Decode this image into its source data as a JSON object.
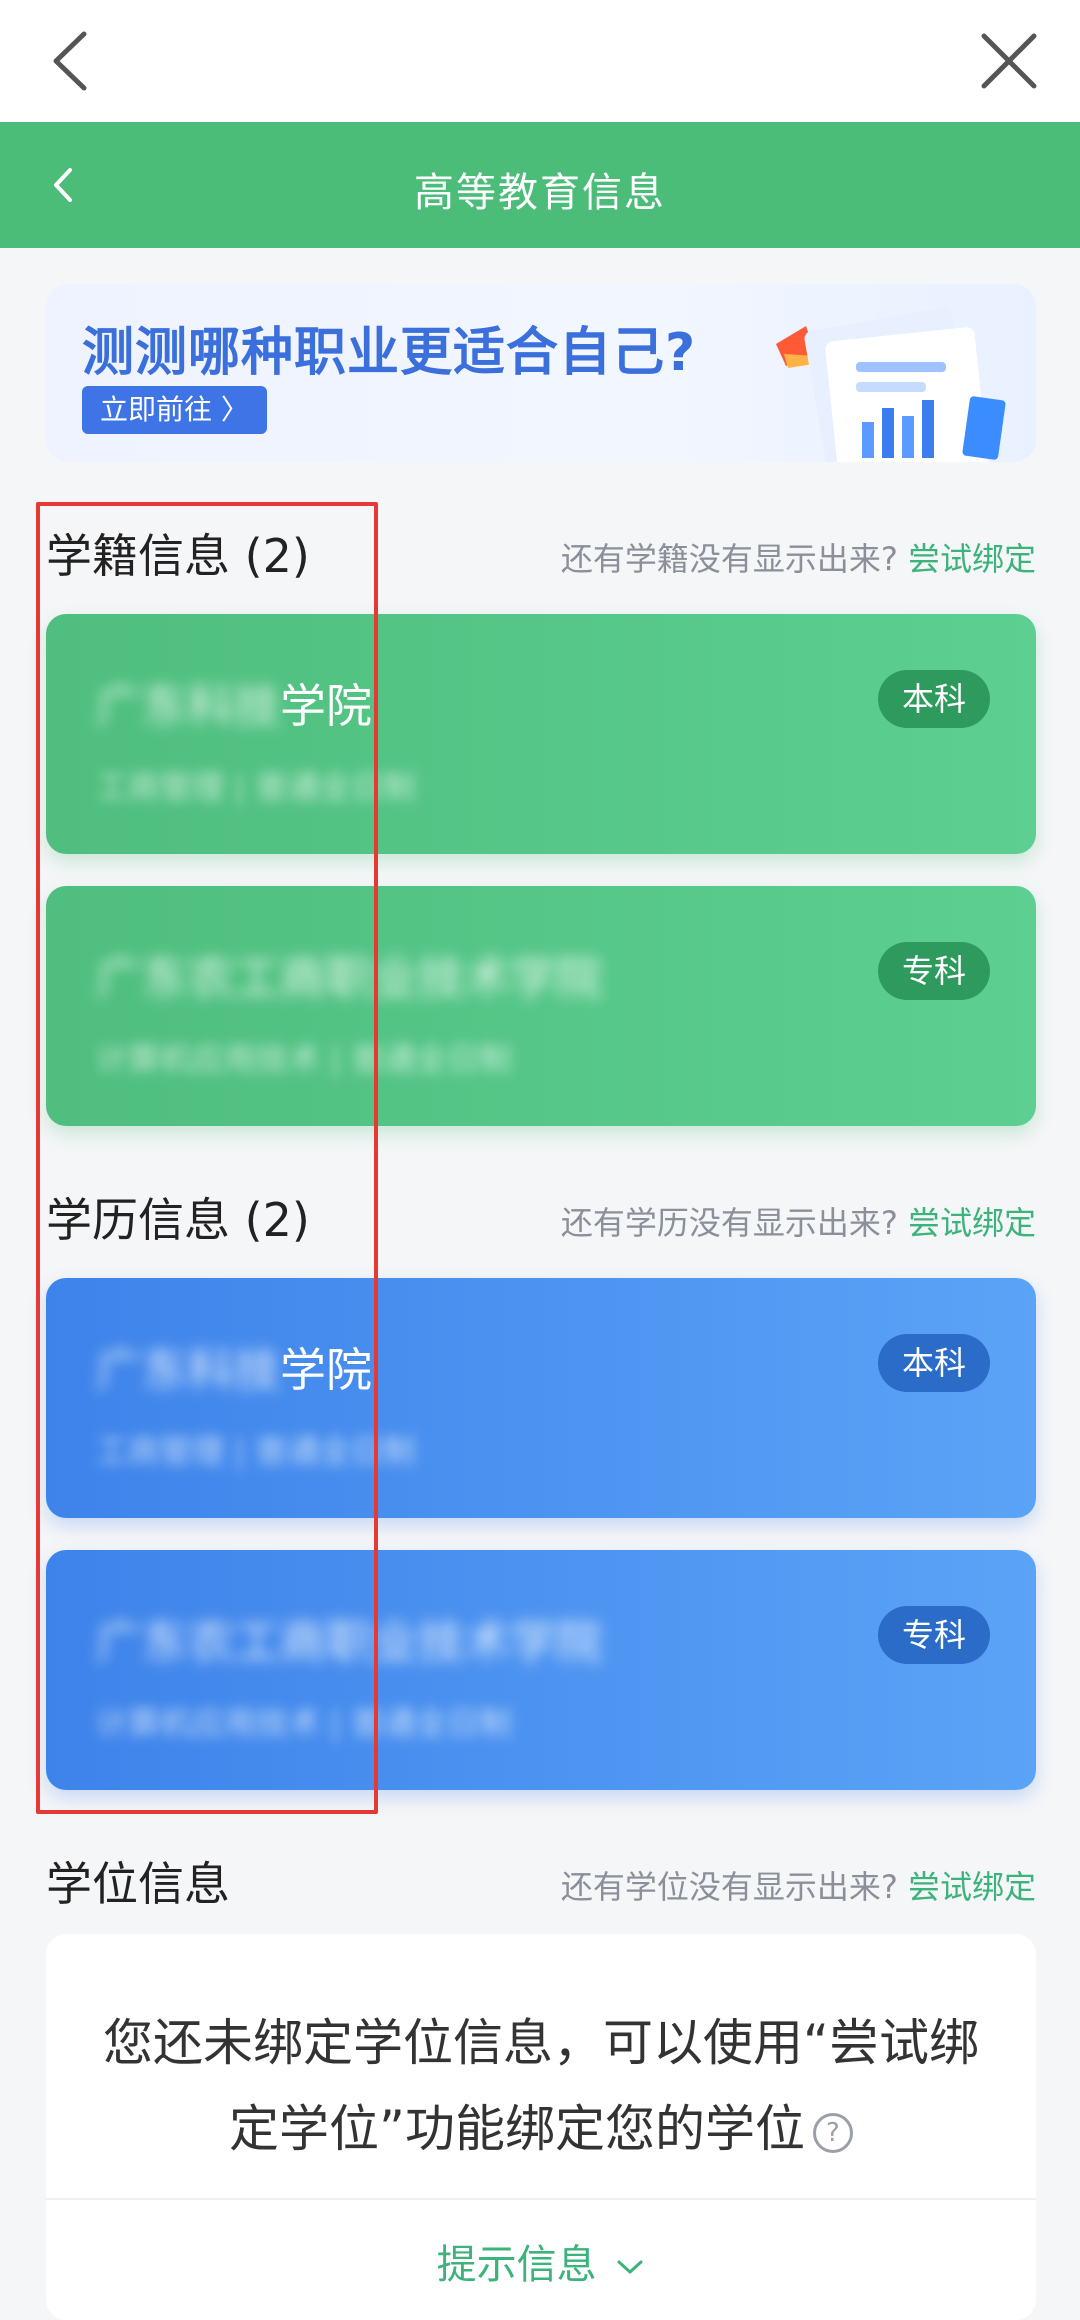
{
  "header": {
    "title": "高等教育信息"
  },
  "banner": {
    "title": "测测哪种职业更适合自己?",
    "button_label": "立即前往 〉"
  },
  "sections": {
    "student_status": {
      "title": "学籍信息 (2)",
      "hint": "还有学籍没有显示出来?",
      "link": "尝试绑定",
      "cards": [
        {
          "name_blur": "广东科技",
          "name_visible": "学院",
          "sub": "工商管理 | 普通全日制",
          "badge": "本科"
        },
        {
          "name_blur": "广东农工商职业技术学院",
          "name_visible": "",
          "sub": "计算机应用技术 | 普通全日制",
          "badge": "专科"
        }
      ]
    },
    "education": {
      "title": "学历信息 (2)",
      "hint": "还有学历没有显示出来?",
      "link": "尝试绑定",
      "cards": [
        {
          "name_blur": "广东科技",
          "name_visible": "学院",
          "sub": "工商管理 | 普通全日制",
          "badge": "本科"
        },
        {
          "name_blur": "广东农工商职业技术学院",
          "name_visible": "",
          "sub": "计算机应用技术 | 普通全日制",
          "badge": "专科"
        }
      ]
    },
    "degree": {
      "title": "学位信息",
      "hint": "还有学位没有显示出来?",
      "link": "尝试绑定",
      "message": "您还未绑定学位信息，可以使用“尝试绑定学位”功能绑定您的学位",
      "tip_label": "提示信息",
      "question_mark": "?"
    }
  },
  "colors": {
    "header_green": "#4bbd79",
    "card_green": "#52c585",
    "card_blue": "#4a90ef",
    "link_green": "#3cb37a",
    "highlight_red": "#e53935"
  }
}
